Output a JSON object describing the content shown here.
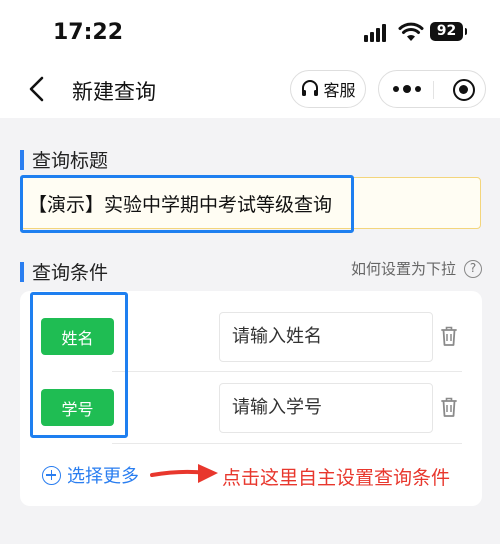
{
  "status_bar": {
    "time": "17:22",
    "battery": "92"
  },
  "nav": {
    "title": "新建查询",
    "service_label": "客服"
  },
  "title_section": {
    "label": "查询标题",
    "value": "【演示】实验中学期中考试等级查询"
  },
  "condition_section": {
    "label": "查询条件",
    "help_text": "如何设置为下拉",
    "help_icon": "?",
    "rows": [
      {
        "tag": "姓名",
        "placeholder": "请输入姓名"
      },
      {
        "tag": "学号",
        "placeholder": "请输入学号"
      }
    ],
    "more_label": "选择更多",
    "annotation": "点击这里自主设置查询条件"
  },
  "colors": {
    "accent_blue": "#2a7ef0",
    "tag_green": "#1fbd53",
    "annotation_red": "#e8372d"
  }
}
